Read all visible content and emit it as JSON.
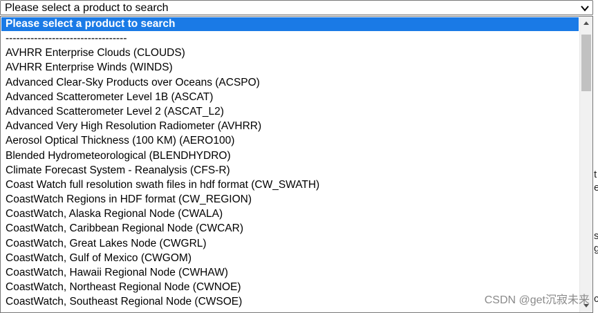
{
  "select": {
    "value": "Please select a product to search",
    "chevron_icon": "chevron-down-icon"
  },
  "dropdown": {
    "options": [
      "Please select a product to search",
      "----------------------------------",
      "AVHRR Enterprise Clouds (CLOUDS)",
      "AVHRR Enterprise Winds (WINDS)",
      "Advanced Clear-Sky Products over Oceans (ACSPO)",
      "Advanced Scatterometer Level 1B (ASCAT)",
      "Advanced Scatterometer Level 2 (ASCAT_L2)",
      "Advanced Very High Resolution Radiometer (AVHRR)",
      "Aerosol Optical Thickness (100 KM) (AERO100)",
      "Blended Hydrometeorological (BLENDHYDRO)",
      "Climate Forecast System - Reanalysis (CFS-R)",
      "Coast Watch full resolution swath files in hdf format (CW_SWATH)",
      "CoastWatch Regions in HDF format (CW_REGION)",
      "CoastWatch, Alaska Regional Node (CWALA)",
      "CoastWatch, Caribbean Regional Node (CWCAR)",
      "CoastWatch, Great Lakes Node (CWGRL)",
      "CoastWatch, Gulf of Mexico (CWGOM)",
      "CoastWatch, Hawaii Regional Node (CWHAW)",
      "CoastWatch, Northeast Regional Node (CWNOE)",
      "CoastWatch, Southeast Regional Node (CWSOE)"
    ],
    "selected_index": 0,
    "highlight_color": "#1a7ae6"
  },
  "background": {
    "fragments": [
      "t",
      "e",
      "s",
      "g",
      "c"
    ]
  },
  "watermark": "CSDN @get沉寂未来"
}
